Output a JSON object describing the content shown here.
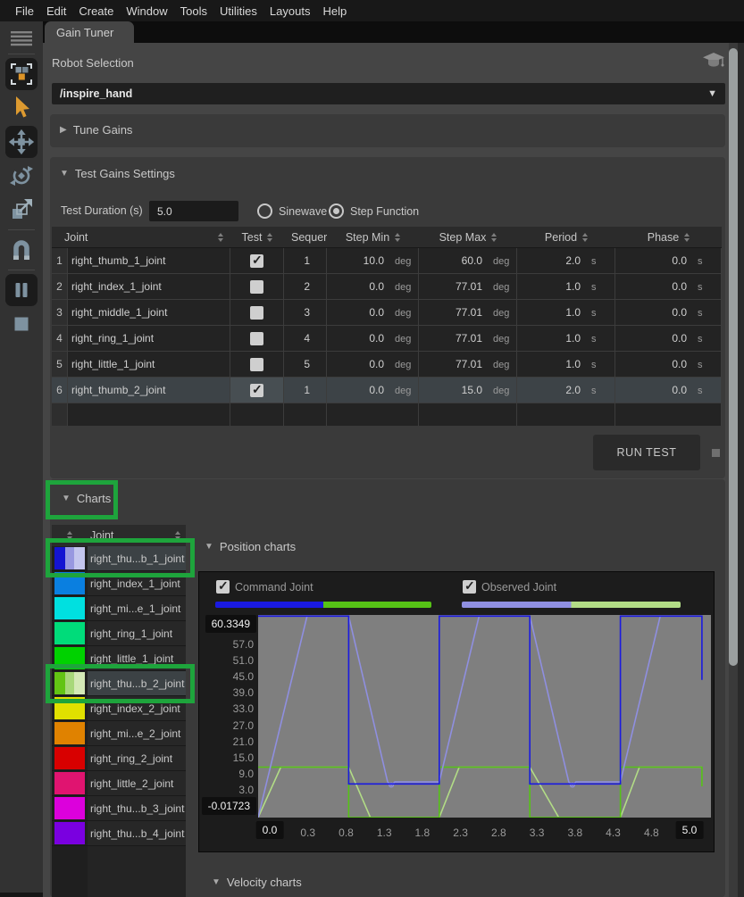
{
  "menu": {
    "items": [
      "File",
      "Edit",
      "Create",
      "Window",
      "Tools",
      "Utilities",
      "Layouts",
      "Help"
    ]
  },
  "tab": {
    "label": "Gain Tuner"
  },
  "toolbar": {
    "icons": [
      "hamburger-menu",
      "selection-mode",
      "cursor-select",
      "move-tool",
      "rotate-tool",
      "scale-tool",
      "snap-magnet",
      "pause",
      "stop"
    ]
  },
  "robot_selection": {
    "label": "Robot Selection",
    "value": "/inspire_hand"
  },
  "sections": {
    "tune_gains": "Tune Gains",
    "test_gains": "Test Gains Settings",
    "charts": "Charts",
    "position_charts": "Position charts",
    "velocity_charts": "Velocity charts"
  },
  "test_settings": {
    "duration_label": "Test Duration (s)",
    "duration_value": "5.0",
    "radio_options": [
      {
        "label": "Sinewave",
        "selected": false
      },
      {
        "label": "Step Function",
        "selected": true
      }
    ]
  },
  "table": {
    "columns": [
      "Joint",
      "Test",
      "Sequer",
      "Step Min",
      "Step Max",
      "Period",
      "Phase"
    ],
    "units": {
      "angle": "deg",
      "time": "s"
    },
    "rows": [
      {
        "num": "1",
        "joint": "right_thumb_1_joint",
        "test": true,
        "seq": "1",
        "min": "10.0",
        "max": "60.0",
        "period": "2.0",
        "phase": "0.0",
        "selected": false
      },
      {
        "num": "2",
        "joint": "right_index_1_joint",
        "test": false,
        "seq": "2",
        "min": "0.0",
        "max": "77.01",
        "period": "1.0",
        "phase": "0.0",
        "selected": false
      },
      {
        "num": "3",
        "joint": "right_middle_1_joint",
        "test": false,
        "seq": "3",
        "min": "0.0",
        "max": "77.01",
        "period": "1.0",
        "phase": "0.0",
        "selected": false
      },
      {
        "num": "4",
        "joint": "right_ring_1_joint",
        "test": false,
        "seq": "4",
        "min": "0.0",
        "max": "77.01",
        "period": "1.0",
        "phase": "0.0",
        "selected": false
      },
      {
        "num": "5",
        "joint": "right_little_1_joint",
        "test": false,
        "seq": "5",
        "min": "0.0",
        "max": "77.01",
        "period": "1.0",
        "phase": "0.0",
        "selected": false
      },
      {
        "num": "6",
        "joint": "right_thumb_2_joint",
        "test": true,
        "seq": "1",
        "min": "0.0",
        "max": "15.0",
        "period": "2.0",
        "phase": "0.0",
        "selected": true
      }
    ]
  },
  "run_test": {
    "label": "RUN TEST"
  },
  "joint_list": {
    "header": "Joint",
    "rows": [
      {
        "name": "right_thu...b_1_joint",
        "colors": [
          "#1414d2",
          "#9898e0",
          "#c4c6ee"
        ],
        "selected": true,
        "annotated": true
      },
      {
        "name": "right_index_1_joint",
        "colors": [
          "#0a7fe0"
        ],
        "selected": false,
        "annotated": false
      },
      {
        "name": "right_mi...e_1_joint",
        "colors": [
          "#00e0e0"
        ],
        "selected": false,
        "annotated": false
      },
      {
        "name": "right_ring_1_joint",
        "colors": [
          "#00dc7a"
        ],
        "selected": false,
        "annotated": false
      },
      {
        "name": "right_little_1_joint",
        "colors": [
          "#00d200"
        ],
        "selected": false,
        "annotated": false
      },
      {
        "name": "right_thu...b_2_joint",
        "colors": [
          "#63c414",
          "#a8d87a",
          "#d4e9b6"
        ],
        "selected": true,
        "annotated": true
      },
      {
        "name": "right_index_2_joint",
        "colors": [
          "#e0e000"
        ],
        "selected": false,
        "annotated": false
      },
      {
        "name": "right_mi...e_2_joint",
        "colors": [
          "#e08200"
        ],
        "selected": false,
        "annotated": false
      },
      {
        "name": "right_ring_2_joint",
        "colors": [
          "#d80000"
        ],
        "selected": false,
        "annotated": false
      },
      {
        "name": "right_little_2_joint",
        "colors": [
          "#e01470"
        ],
        "selected": false,
        "annotated": false
      },
      {
        "name": "right_thu...b_3_joint",
        "colors": [
          "#dc00dc"
        ],
        "selected": false,
        "annotated": false
      },
      {
        "name": "right_thu...b_4_joint",
        "colors": [
          "#7a00e0"
        ],
        "selected": false,
        "annotated": false
      }
    ]
  },
  "legend": {
    "command": {
      "label": "Command Joint",
      "checked": true,
      "colors": [
        "#1a1ae0",
        "#56c216"
      ]
    },
    "observed": {
      "label": "Observed Joint",
      "checked": true,
      "colors": [
        "#8f8fe0",
        "#b2dc86"
      ]
    }
  },
  "chart_data": {
    "type": "line",
    "title": "Position charts",
    "xlabel": "",
    "ylabel": "",
    "xlim": [
      0,
      5
    ],
    "ylim": [
      -0.01723,
      60.3349
    ],
    "grid": false,
    "legend_position": "top",
    "plot_bg": "#7f7f7f",
    "x_ticks": [
      "0.0",
      "0.3",
      "0.8",
      "1.3",
      "1.8",
      "2.3",
      "2.8",
      "3.3",
      "3.8",
      "4.3",
      "4.8",
      "5.0"
    ],
    "y_ticks": [
      "60.3349",
      "57.0",
      "51.0",
      "45.0",
      "39.0",
      "33.0",
      "27.0",
      "21.0",
      "15.0",
      "9.0",
      "3.0",
      "-0.01723"
    ],
    "series": [
      {
        "name": "observed_right_thumb_2_joint",
        "color": "#b2dc86",
        "points": [
          [
            0,
            0
          ],
          [
            0.25,
            15
          ],
          [
            1,
            15
          ],
          [
            1.24,
            0
          ],
          [
            2,
            0
          ],
          [
            2.22,
            15
          ],
          [
            3,
            15
          ],
          [
            3.32,
            0
          ],
          [
            4,
            0
          ],
          [
            4.21,
            15
          ],
          [
            4.9,
            15
          ]
        ]
      },
      {
        "name": "command_right_thumb_2_joint",
        "color": "#56c216",
        "points": [
          [
            0,
            15
          ],
          [
            1,
            15
          ],
          [
            1,
            0
          ],
          [
            2,
            0
          ],
          [
            2,
            15
          ],
          [
            3,
            15
          ],
          [
            3,
            0
          ],
          [
            4,
            0
          ],
          [
            4,
            15
          ],
          [
            4.9,
            15
          ],
          [
            4.9,
            9.3
          ]
        ]
      },
      {
        "name": "observed_right_thumb_1_joint",
        "color": "#8f8fe0",
        "points": [
          [
            0,
            0
          ],
          [
            0.54,
            60
          ],
          [
            1,
            60
          ],
          [
            1.43,
            10.6
          ],
          [
            1.47,
            9.6
          ],
          [
            1.51,
            10.6
          ],
          [
            2,
            10.6
          ],
          [
            2.44,
            60
          ],
          [
            3,
            60
          ],
          [
            3.43,
            10.6
          ],
          [
            3.47,
            9.6
          ],
          [
            3.51,
            10.6
          ],
          [
            4,
            10.6
          ],
          [
            4.44,
            60
          ],
          [
            4.9,
            60
          ]
        ],
        "markers": [
          [
            1.47,
            9.7
          ],
          [
            3.47,
            9.7
          ]
        ]
      },
      {
        "name": "command_right_thumb_1_joint",
        "color": "#1a1ae0",
        "points": [
          [
            0,
            60
          ],
          [
            1,
            60
          ],
          [
            1,
            10
          ],
          [
            2,
            10
          ],
          [
            2,
            60
          ],
          [
            3,
            60
          ],
          [
            3,
            10
          ],
          [
            4,
            10
          ],
          [
            4,
            60
          ],
          [
            4.9,
            60
          ],
          [
            4.9,
            41
          ]
        ]
      }
    ]
  },
  "annotation_color": "#1ea43c"
}
